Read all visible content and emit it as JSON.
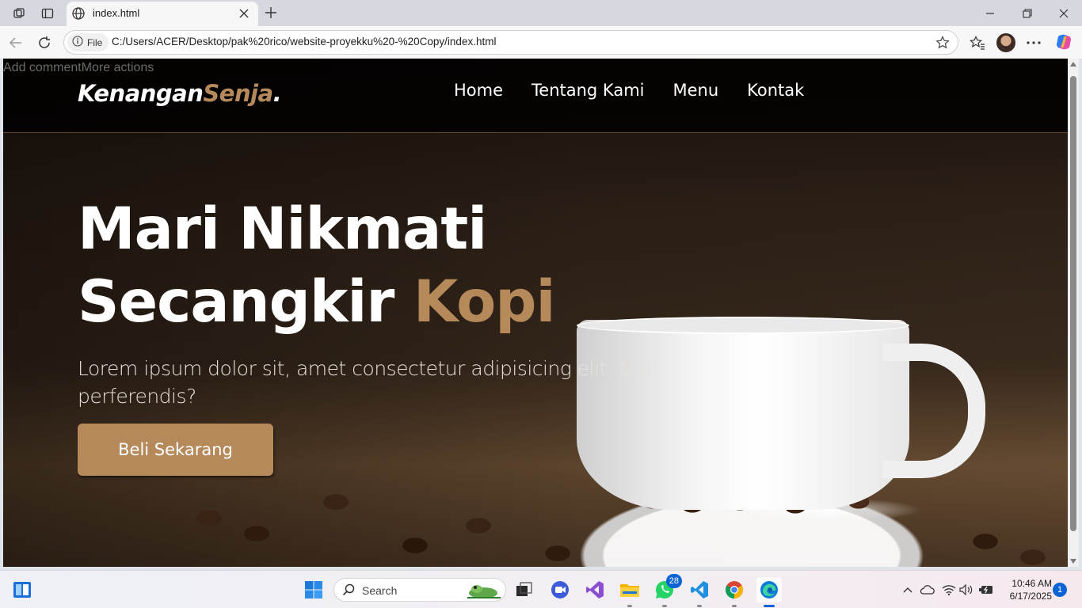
{
  "browser": {
    "tab_title": "index.html",
    "site_chip_label": "File",
    "url": "C:/Users/ACER/Desktop/pak%20rico/website-proyekku%20-%20Copy/index.html"
  },
  "page": {
    "comment_bar": "Add commentMore actions",
    "logo": {
      "main": "Kenangan",
      "accent": "Senja",
      "dot": "."
    },
    "nav": [
      {
        "label": "Home"
      },
      {
        "label": "Tentang Kami"
      },
      {
        "label": "Menu"
      },
      {
        "label": "Kontak"
      }
    ],
    "hero": {
      "title_line1": "Mari Nikmati",
      "title_line2": "Secangkir ",
      "title_accent": "Kopi",
      "text": "Lorem ipsum dolor sit, amet consectetur adipisicing elit. Qui, perferendis?",
      "cta_label": "Beli Sekarang"
    },
    "accent_color": "#b6895b"
  },
  "taskbar": {
    "search_label": "Search",
    "whatsapp_badge": "28",
    "time": "10:46 AM",
    "date": "6/17/2025",
    "notification_count": "1",
    "apps": [
      "start-icon",
      "search-icon",
      "task-view-icon",
      "zoom-icon",
      "visual-studio-icon",
      "file-explorer-icon",
      "whatsapp-icon",
      "vscode-icon",
      "chrome-icon",
      "edge-icon"
    ]
  }
}
